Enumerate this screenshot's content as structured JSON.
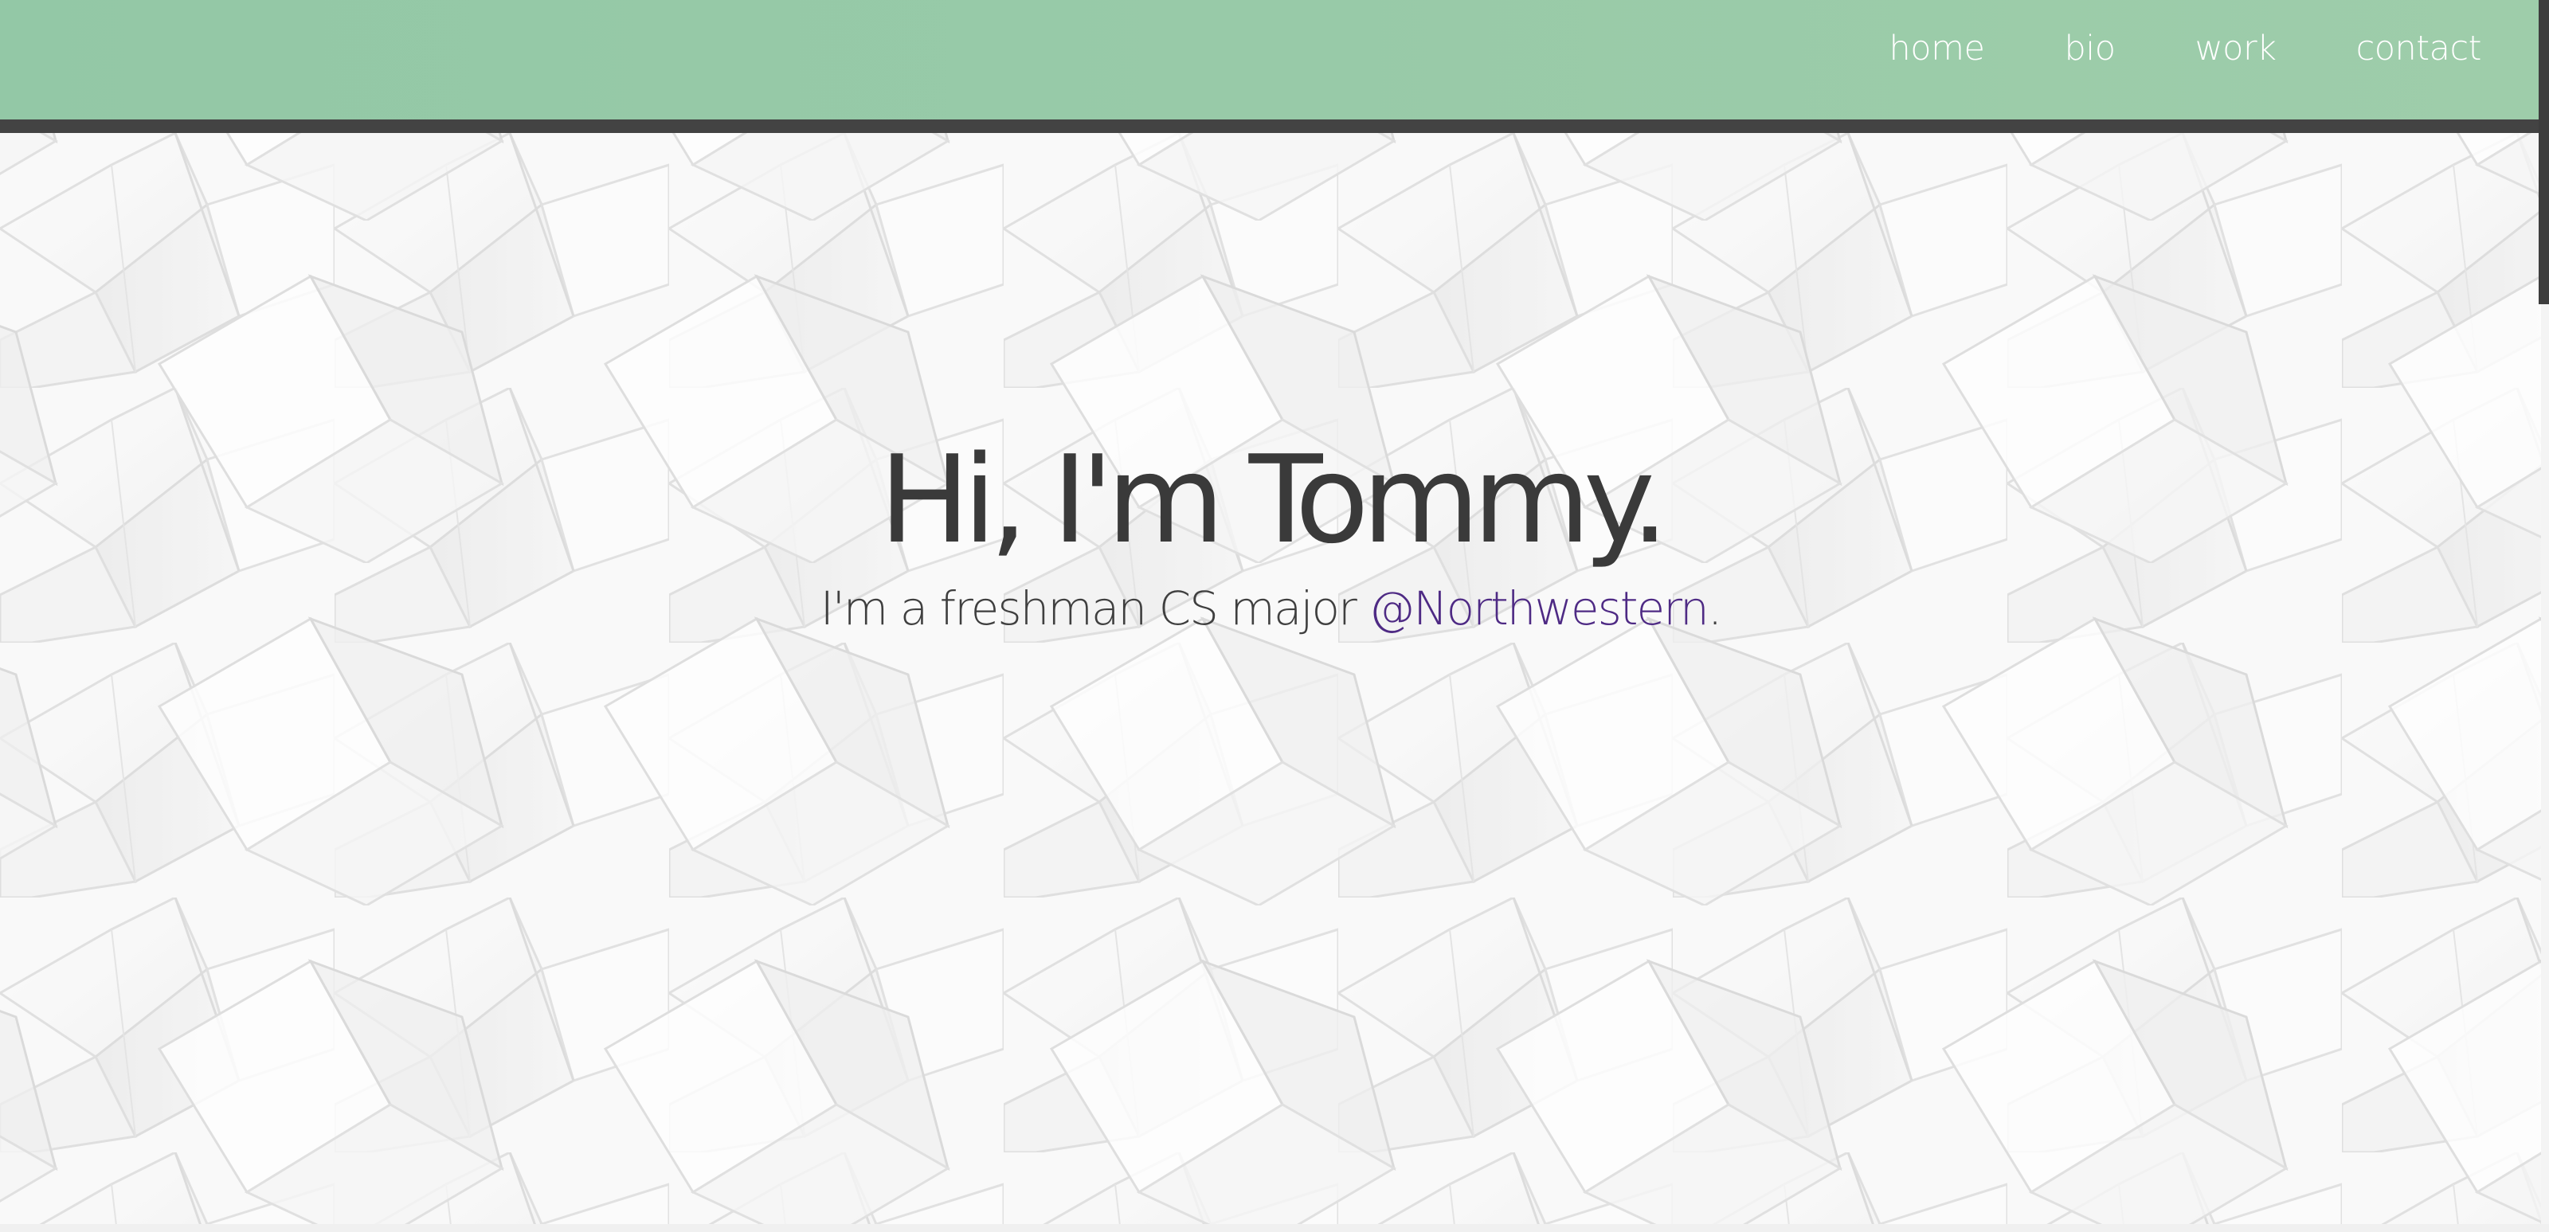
{
  "nav": {
    "links": [
      {
        "label": "home"
      },
      {
        "label": "bio"
      },
      {
        "label": "work"
      },
      {
        "label": "contact"
      }
    ]
  },
  "hero": {
    "title": "Hi, I'm Tommy.",
    "subtitle_prefix": "I'm a freshman CS major ",
    "subtitle_link": "@Northwestern",
    "subtitle_suffix": "."
  },
  "colors": {
    "nav_green": "#96c9a7",
    "nav_border": "#434343",
    "link_purple": "#4e2a84",
    "text_dark": "#3a3a3a"
  },
  "background": {
    "pattern_name": "white-geometric-folded-panels"
  }
}
